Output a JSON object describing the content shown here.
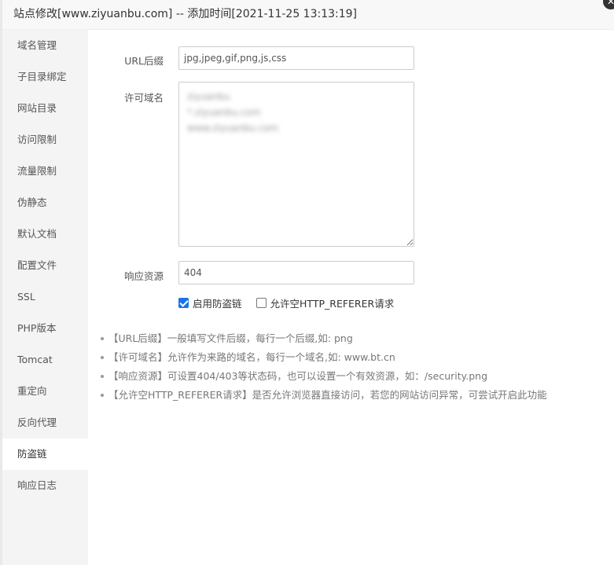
{
  "dialog": {
    "title": "站点修改[www.ziyuanbu.com] -- 添加时间[2021-11-25 13:13:19]",
    "close_icon": "close-icon"
  },
  "sidebar": {
    "items": [
      {
        "label": "域名管理"
      },
      {
        "label": "子目录绑定"
      },
      {
        "label": "网站目录"
      },
      {
        "label": "访问限制"
      },
      {
        "label": "流量限制"
      },
      {
        "label": "伪静态"
      },
      {
        "label": "默认文档"
      },
      {
        "label": "配置文件"
      },
      {
        "label": "SSL"
      },
      {
        "label": "PHP版本"
      },
      {
        "label": "Tomcat"
      },
      {
        "label": "重定向"
      },
      {
        "label": "反向代理"
      },
      {
        "label": "防盗链"
      },
      {
        "label": "响应日志"
      }
    ],
    "active_index": 13
  },
  "form": {
    "url_suffix_label": "URL后缀",
    "url_suffix_value": "jpg,jpeg,gif,png,js,css",
    "allowed_domains_label": "许可域名",
    "allowed_domains": [
      "ziyuanbu",
      "*.ziyuanbu.com",
      "www.ziyuanbu.com"
    ],
    "response_label": "响应资源",
    "response_value": "404",
    "enable_hotlink_label": "启用防盗链",
    "enable_hotlink_checked": true,
    "allow_empty_referer_label": "允许空HTTP_REFERER请求",
    "allow_empty_referer_checked": false
  },
  "tips": [
    "【URL后缀】一般填写文件后缀，每行一个后缀,如: png",
    "【许可域名】允许作为来路的域名，每行一个域名,如: www.bt.cn",
    "【响应资源】可设置404/403等状态码，也可以设置一个有效资源，如：/security.png",
    "【允许空HTTP_REFERER请求】是否允许浏览器直接访问，若您的网站访问异常，可尝试开启此功能"
  ]
}
